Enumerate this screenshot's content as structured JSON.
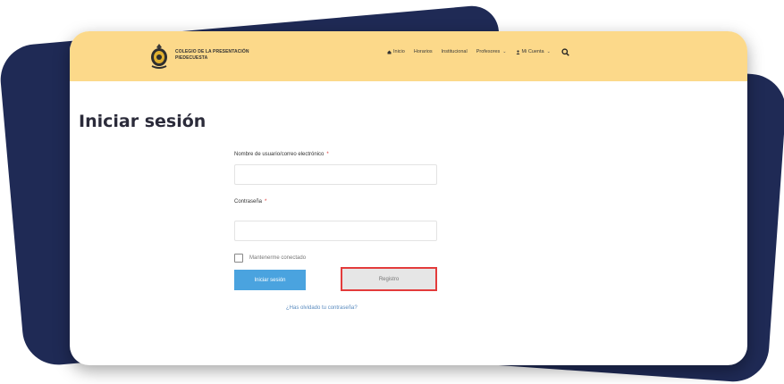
{
  "header": {
    "logo_line1": "COLEGIO DE LA PRESENTACIÓN",
    "logo_line2": "PIEDECUESTA"
  },
  "nav": {
    "items": [
      {
        "label": "Inicio"
      },
      {
        "label": "Horarios"
      },
      {
        "label": "Institucional"
      },
      {
        "label": "Profesores"
      },
      {
        "label": "Mi Cuenta"
      }
    ]
  },
  "page": {
    "title": "Iniciar sesión"
  },
  "form": {
    "username_label": "Nombre de usuario/correo electrónico",
    "password_label": "Contraseña",
    "required_mark": "*",
    "remember_label": "Mantenerme conectado",
    "login_button": "Iniciar sesión",
    "register_button": "Registro",
    "forgot_link": "¿Has olvidado tu contraseña?"
  },
  "colors": {
    "header_bg": "#fcd98a",
    "backdrop": "#1f2a55",
    "login_button": "#4aa3df",
    "register_highlight": "#e33b3b"
  },
  "icons": [
    "home-icon",
    "user-icon",
    "search-icon",
    "chevron-down-icon"
  ]
}
